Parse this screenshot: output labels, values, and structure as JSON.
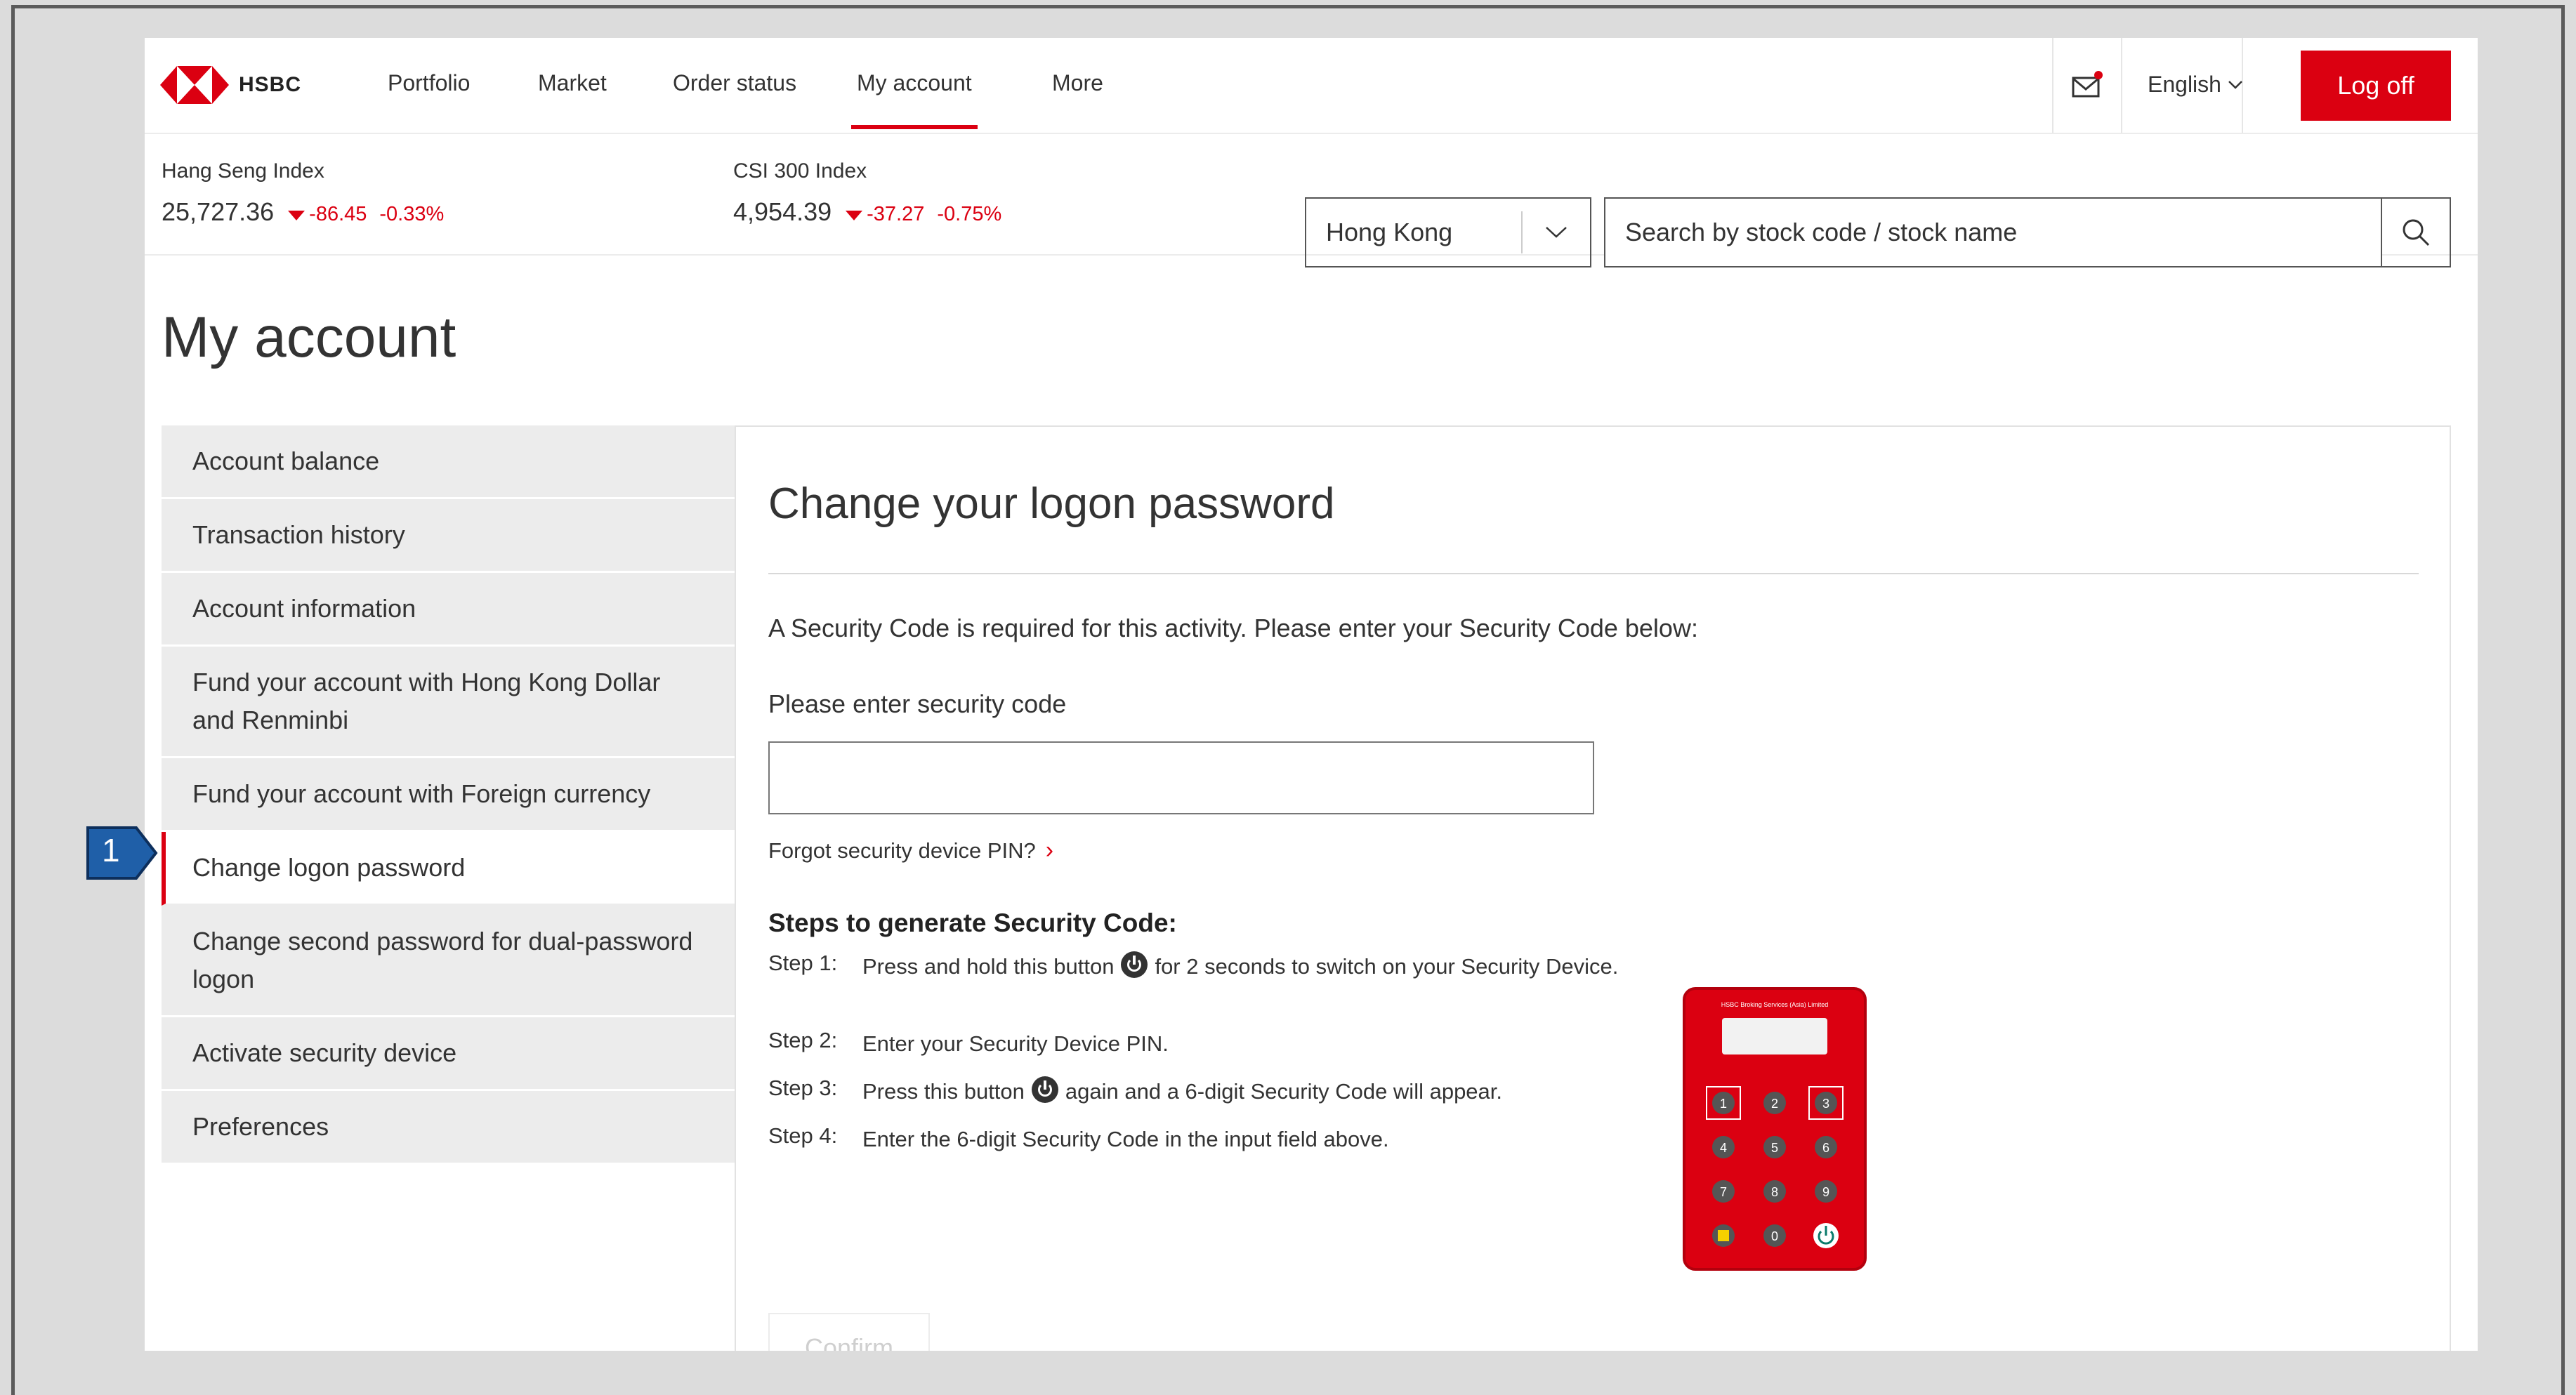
{
  "brand": {
    "name": "HSBC",
    "red": "#db0011"
  },
  "nav": {
    "items": [
      {
        "label": "Portfolio",
        "active": false
      },
      {
        "label": "Market",
        "active": false
      },
      {
        "label": "Order status",
        "active": false
      },
      {
        "label": "My account",
        "active": true
      },
      {
        "label": "More",
        "active": false
      }
    ],
    "mail_icon": "mail-icon",
    "language": "English",
    "logoff_label": "Log off"
  },
  "indices": [
    {
      "name": "Hang Seng Index",
      "value": "25,727.36",
      "change": "-86.45",
      "pct": "-0.33%"
    },
    {
      "name": "CSI 300 Index",
      "value": "4,954.39",
      "change": "-37.27",
      "pct": "-0.75%"
    }
  ],
  "market_select": {
    "value": "Hong Kong"
  },
  "search": {
    "placeholder": "Search by stock code / stock name"
  },
  "page_title": "My account",
  "sidebar": {
    "items": [
      {
        "label": "Account balance",
        "active": false
      },
      {
        "label": "Transaction history",
        "active": false
      },
      {
        "label": "Account information",
        "active": false
      },
      {
        "label": "Fund your account with Hong Kong Dollar and Renminbi",
        "active": false
      },
      {
        "label": "Fund your account with Foreign currency",
        "active": false
      },
      {
        "label": "Change logon password",
        "active": true
      },
      {
        "label": "Change second password for dual-password logon",
        "active": false
      },
      {
        "label": "Activate security device",
        "active": false
      },
      {
        "label": "Preferences",
        "active": false
      }
    ]
  },
  "panel": {
    "title": "Change your logon password",
    "security_text": "A Security Code is required for this activity. Please enter your Security Code below:",
    "code_label": "Please enter security code",
    "code_value": "",
    "forgot_label": "Forgot security device PIN?",
    "steps_title": "Steps to generate Security Code:",
    "steps": [
      {
        "num": "Step 1:",
        "before": "Press and hold this button",
        "after": "for 2 seconds to switch on your Security Device."
      },
      {
        "num": "Step 2:",
        "before": "Enter your Security Device PIN.",
        "after": ""
      },
      {
        "num": "Step 3:",
        "before": "Press this button",
        "after": "again and a 6-digit Security Code will appear."
      },
      {
        "num": "Step 4:",
        "before": "Enter the 6-digit Security Code in the input field above.",
        "after": ""
      }
    ],
    "device_label": "HSBC Broking Services (Asia) Limited",
    "device_keys": [
      "1",
      "2",
      "3",
      "4",
      "5",
      "6",
      "7",
      "8",
      "9",
      "0"
    ],
    "confirm_label": "Confirm"
  },
  "callout": {
    "label": "1"
  }
}
